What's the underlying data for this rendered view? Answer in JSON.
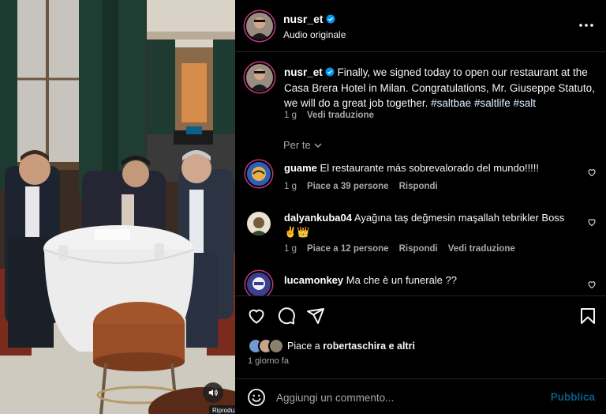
{
  "colors": {
    "background": "#000000",
    "link_blue": "#0095f6",
    "muted_text": "#a8a8a8",
    "publish_disabled": "#0b5a87",
    "story_ring": "#c13584"
  },
  "media": {
    "sound_icon": "speaker-icon",
    "tooltip": "Riproduzione in corso"
  },
  "header": {
    "username": "nusr_et",
    "audio": "Audio originale",
    "more_icon": "more-horizontal-icon"
  },
  "caption": {
    "username": "nusr_et",
    "text": "Finally, we signed today to open our restaurant at the Casa Brera Hotel in Milan. Congratulations, Mr. Giuseppe Statuto, we will do a great job together.",
    "hashtags": [
      "#saltbae",
      "#saltlife",
      "#salt"
    ],
    "time": "1 g",
    "translate": "Vedi traduzione"
  },
  "per_te": "Per te",
  "comments": [
    {
      "username": "guame",
      "text": "El restaurante más sobrevalorado del mundo!!!!!",
      "time": "1 g",
      "likes": "Piace a 39 persone",
      "reply": "Rispondi",
      "translate": ""
    },
    {
      "username": "dalyankuba04",
      "text": "Ayağına taş değmesin maşallah tebrikler Boss ✌️👑",
      "time": "1 g",
      "likes": "Piace a 12 persone",
      "reply": "Rispondi",
      "translate": "Vedi traduzione"
    },
    {
      "username": "lucamonkey",
      "text": "Ma che è un funerale ??",
      "time": "",
      "likes": "",
      "reply": "",
      "translate": ""
    }
  ],
  "actions": {
    "like_icon": "heart-icon",
    "comment_icon": "comment-icon",
    "share_icon": "paper-plane-icon",
    "save_icon": "bookmark-icon"
  },
  "likes": {
    "prefix": "Piace a",
    "user": "robertaschira",
    "suffix": "e altri"
  },
  "post_time": "1 giorno fa",
  "composer": {
    "placeholder": "Aggiungi un commento...",
    "publish": "Pubblica",
    "emoji_icon": "emoji-smile-icon"
  }
}
